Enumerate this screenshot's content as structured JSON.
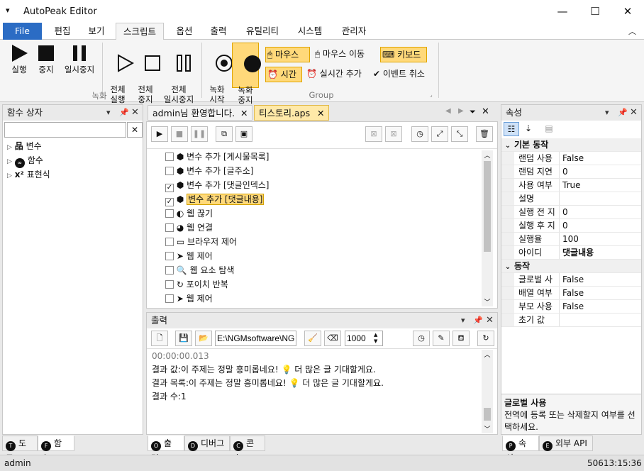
{
  "app": {
    "title": "AutoPeak Editor"
  },
  "menu_tabs": [
    "File",
    "편집",
    "보기",
    "스크립트",
    "옵션",
    "출력",
    "유틸리티",
    "시스템",
    "관리자"
  ],
  "ribbon": {
    "record_group": {
      "run": "실행",
      "stop": "중지",
      "pause": "일시중지",
      "all_run": "전체\n실행",
      "all_stop": "전체\n중지",
      "all_pause": "전체\n일시중지",
      "label": "녹화"
    },
    "rec_group": {
      "rec_start": "녹화\n시작",
      "rec_stop": "녹화\n중지"
    },
    "group2": {
      "mouse_click": "마우스",
      "mouse_move": "마우스 이동",
      "keyboard": "키보드",
      "time": "시간",
      "realtime_add": "실시간 추가",
      "event_cancel": "이벤트 취소",
      "label": "Group"
    }
  },
  "function_box": {
    "title": "함수 상자",
    "search_value": "",
    "items": [
      {
        "icon": "variable-icon",
        "label": "변수"
      },
      {
        "icon": "function-icon",
        "label": "함수"
      },
      {
        "icon": "expression-icon",
        "label": "표현식"
      }
    ],
    "tabs": [
      {
        "key": "T",
        "label": "도구"
      },
      {
        "key": "F",
        "label": "함수"
      }
    ]
  },
  "editor": {
    "tabs": [
      {
        "label": "admin님 환영합니다."
      },
      {
        "label": "티스토리.aps"
      }
    ],
    "rows": [
      {
        "checked": false,
        "icon": "variable-icon",
        "label": "변수 추가 [게시물목록]"
      },
      {
        "checked": false,
        "icon": "variable-icon",
        "label": "변수 추가 [글주소]"
      },
      {
        "checked": true,
        "icon": "variable-icon",
        "label": "변수 추가 [댓글인덱스]"
      },
      {
        "checked": true,
        "icon": "variable-icon",
        "label": "변수 추가 [댓글내용]",
        "selected": true
      },
      {
        "checked": false,
        "icon": "web-disconnect-icon",
        "label": "웹 끊기"
      },
      {
        "checked": false,
        "icon": "web-connect-icon",
        "label": "웹 연결"
      },
      {
        "checked": false,
        "icon": "browser-icon",
        "label": "브라우저 제어"
      },
      {
        "checked": false,
        "icon": "web-control-icon",
        "label": "웹 제어"
      },
      {
        "checked": false,
        "icon": "web-search-icon",
        "label": "웹 요소 탐색"
      },
      {
        "checked": false,
        "icon": "loop-icon",
        "label": "포이치 반복"
      },
      {
        "checked": false,
        "icon": "web-control-icon",
        "label": "웹 제어"
      }
    ]
  },
  "output": {
    "title": "출력",
    "path": "E:\\NGMsoftware\\NG",
    "count": "1000",
    "lines": [
      "00:00:00.013",
      "결과 값:이 주제는 정말 흥미롭네요! 💡 더 많은 글 기대할게요.",
      "결과 목록:이 주제는 정말 흥미롭네요! 💡 더 많은 글 기대할게요.",
      "결과 수:1"
    ],
    "tabs": [
      {
        "key": "O",
        "label": "출력"
      },
      {
        "key": "D",
        "label": "디버그"
      },
      {
        "key": "C",
        "label": "콘솔"
      }
    ]
  },
  "properties": {
    "title": "속성",
    "sections": [
      {
        "name": "기본 동작",
        "rows": [
          [
            "랜덤 사용",
            "False"
          ],
          [
            "랜덤 지연",
            "0"
          ],
          [
            "사용 여부",
            "True"
          ],
          [
            "설명",
            ""
          ],
          [
            "실행 전 지",
            "0"
          ],
          [
            "실행 후 지",
            "0"
          ],
          [
            "실행율",
            "100"
          ],
          [
            "아이디",
            "댓글내용"
          ]
        ]
      },
      {
        "name": "동작",
        "rows": [
          [
            "글로벌 사",
            "False"
          ],
          [
            "배열 여부",
            "False"
          ],
          [
            "부모 사용",
            "False"
          ],
          [
            "초기 값",
            ""
          ]
        ]
      }
    ],
    "help_title": "글로벌 사용",
    "help_text": "전역에 등록 또는 삭제할지 여부를 선택하세요.",
    "tabs": [
      {
        "key": "P",
        "label": "속성"
      },
      {
        "key": "E",
        "label": "외부 API"
      }
    ]
  },
  "status": {
    "user": "admin",
    "time": "50613:15:36"
  }
}
